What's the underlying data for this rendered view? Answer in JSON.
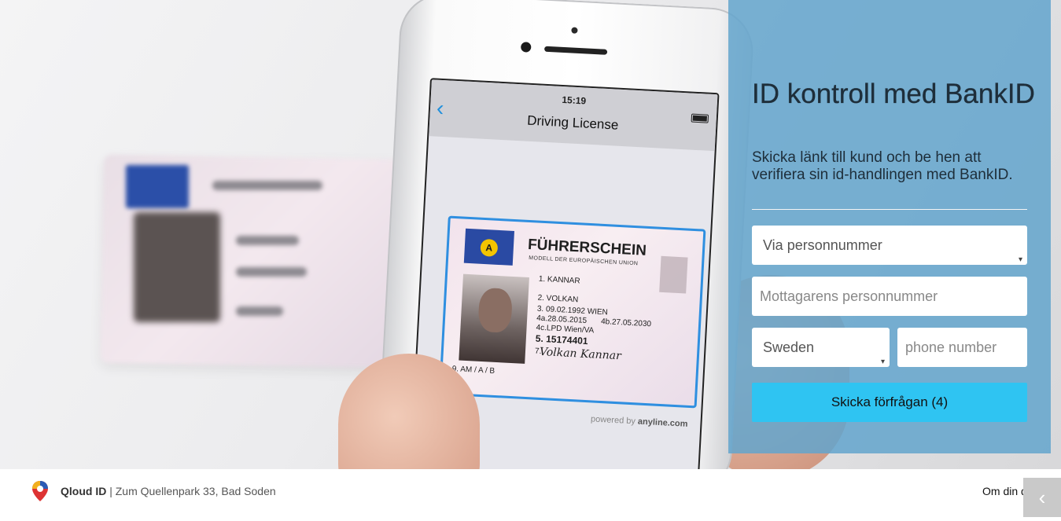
{
  "panel": {
    "title": "ID kontroll med BankID",
    "subtitle": "Skicka länk till kund och be hen att verifiera sin id-handlingen med BankID.",
    "method_select": "Via personnummer",
    "pnr_placeholder": "Mottagarens personnummer",
    "country_select": "Sweden",
    "phone_placeholder": "phone number",
    "submit_label": "Skicka förfrågan (4)"
  },
  "phone_screen": {
    "time": "15:19",
    "nav_title": "Driving License",
    "license": {
      "eu_code": "A",
      "title": "FÜHRERSCHEIN",
      "subtitle": "MODELL DER EUROPÄISCHEN UNION",
      "f1": "1. KANNAR",
      "f2": "2. VOLKAN",
      "f3": "3. 09.02.1992  WIEN",
      "f4a": "4a.28.05.2015",
      "f4b": "4b.27.05.2030",
      "f4c": "4c.LPD Wien/VA",
      "f5": "5. 15174401",
      "f7": "7.",
      "signature": "Volkan Kannar",
      "f9": "9. AM / A / B"
    },
    "powered_prefix": "powered by ",
    "powered_brand": "anyline.com"
  },
  "footer": {
    "brand": "Qloud ID",
    "address": " | Zum Quellenpark 33, Bad Soden",
    "about_link": "Om din data",
    "back_icon": "chevron-left-icon"
  },
  "colors": {
    "panel_bg": "#63a4cc",
    "button_bg": "#2fc4f2",
    "scan_frame": "#2f8fe0"
  }
}
